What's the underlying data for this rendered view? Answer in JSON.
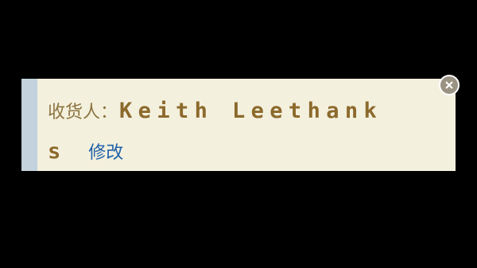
{
  "address": {
    "label": "收货人：",
    "name_line1": "Keith Leethank",
    "name_line2": "s",
    "edit_label": "修改"
  },
  "icons": {
    "close": "close-icon"
  },
  "colors": {
    "background": "#000000",
    "card_background": "#f4f0de",
    "accent_bar": "#c3d2dd",
    "label_text": "#8c7440",
    "name_text": "#8c6a2c",
    "link_text": "#1f62a8"
  }
}
